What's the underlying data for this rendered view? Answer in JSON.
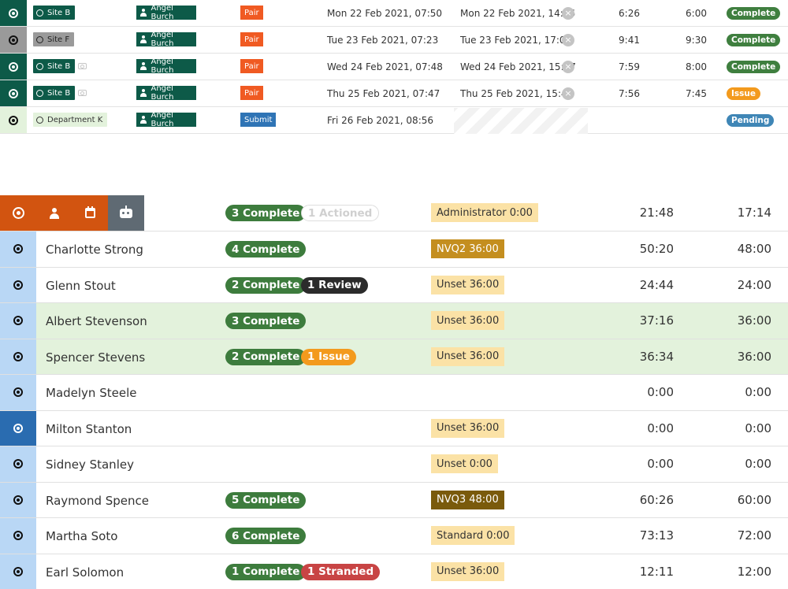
{
  "shifts": [
    {
      "site": "Site B",
      "site_style": "green",
      "camera": false,
      "person": "Angel Burch",
      "action": "Pair",
      "action_style": "pair",
      "start": "Mon 22 Feb 2021, 07:50",
      "end": "Mon 22 Feb 2021, 14:16",
      "clear": "×",
      "worked": "6:26",
      "scheduled": "6:00",
      "status": "Complete",
      "status_style": "complete",
      "selector": "green"
    },
    {
      "site": "Site F",
      "site_style": "grey",
      "camera": false,
      "person": "Angel Burch",
      "action": "Pair",
      "action_style": "pair",
      "start": "Tue 23 Feb 2021, 07:23",
      "end": "Tue 23 Feb 2021, 17:04",
      "clear": "×",
      "worked": "9:41",
      "scheduled": "9:30",
      "status": "Complete",
      "status_style": "complete",
      "selector": "grey"
    },
    {
      "site": "Site B",
      "site_style": "green",
      "camera": true,
      "person": "Angel Burch",
      "action": "Pair",
      "action_style": "pair",
      "start": "Wed 24 Feb 2021, 07:48",
      "end": "Wed 24 Feb 2021, 15:47",
      "clear": "×",
      "worked": "7:59",
      "scheduled": "8:00",
      "status": "Complete",
      "status_style": "complete",
      "selector": "green"
    },
    {
      "site": "Site B",
      "site_style": "green",
      "camera": true,
      "person": "Angel Burch",
      "action": "Pair",
      "action_style": "pair",
      "start": "Thu 25 Feb 2021, 07:47",
      "end": "Thu 25 Feb 2021, 15:43",
      "clear": "×",
      "worked": "7:56",
      "scheduled": "7:45",
      "status": "Issue",
      "status_style": "issue",
      "selector": "green"
    },
    {
      "site": "Department K",
      "site_style": "dept",
      "camera": false,
      "person": "Angel Burch",
      "action": "Submit",
      "action_style": "submit",
      "start": "Fri 26 Feb 2021, 08:56",
      "end": "",
      "clear": "",
      "worked": "",
      "scheduled": "",
      "status": "Pending",
      "status_style": "pending",
      "selector": "light"
    }
  ],
  "staff_header": {
    "pills": [
      {
        "label": "3 Complete",
        "style": "complete"
      },
      {
        "label": "1 Actioned",
        "style": "actioned"
      }
    ],
    "contract": "Administrator 0:00",
    "contract_style": "light",
    "worked": "21:48",
    "scheduled": "17:14",
    "buttons": [
      "target-icon",
      "person-icon",
      "calendar-icon",
      "robot-icon"
    ]
  },
  "staff": [
    {
      "name": "Charlotte Strong",
      "pills": [
        {
          "label": "4 Complete",
          "style": "complete"
        }
      ],
      "contract": "NVQ2 36:00",
      "contract_style": "mid",
      "worked": "50:20",
      "scheduled": "48:00",
      "highlight": false,
      "side": "light"
    },
    {
      "name": "Glenn Stout",
      "pills": [
        {
          "label": "2 Complete",
          "style": "complete"
        },
        {
          "label": "1 Review",
          "style": "review"
        }
      ],
      "contract": "Unset 36:00",
      "contract_style": "light",
      "worked": "24:44",
      "scheduled": "24:00",
      "highlight": false,
      "side": "light"
    },
    {
      "name": "Albert Stevenson",
      "pills": [
        {
          "label": "3 Complete",
          "style": "complete"
        }
      ],
      "contract": "Unset 36:00",
      "contract_style": "light",
      "worked": "37:16",
      "scheduled": "36:00",
      "highlight": true,
      "side": "light"
    },
    {
      "name": "Spencer Stevens",
      "pills": [
        {
          "label": "2 Complete",
          "style": "complete"
        },
        {
          "label": "1 Issue",
          "style": "issue"
        }
      ],
      "contract": "Unset 36:00",
      "contract_style": "light",
      "worked": "36:34",
      "scheduled": "36:00",
      "highlight": true,
      "side": "light"
    },
    {
      "name": "Madelyn Steele",
      "pills": [],
      "contract": "",
      "contract_style": "light",
      "worked": "0:00",
      "scheduled": "0:00",
      "highlight": false,
      "side": "light"
    },
    {
      "name": "Milton Stanton",
      "pills": [],
      "contract": "Unset 36:00",
      "contract_style": "light",
      "worked": "0:00",
      "scheduled": "0:00",
      "highlight": false,
      "side": "dark"
    },
    {
      "name": "Sidney Stanley",
      "pills": [],
      "contract": "Unset 0:00",
      "contract_style": "light",
      "worked": "0:00",
      "scheduled": "0:00",
      "highlight": false,
      "side": "light"
    },
    {
      "name": "Raymond Spence",
      "pills": [
        {
          "label": "5 Complete",
          "style": "complete"
        }
      ],
      "contract": "NVQ3 48:00",
      "contract_style": "dark",
      "worked": "60:26",
      "scheduled": "60:00",
      "highlight": false,
      "side": "light"
    },
    {
      "name": "Martha Soto",
      "pills": [
        {
          "label": "6 Complete",
          "style": "complete"
        }
      ],
      "contract": "Standard 0:00",
      "contract_style": "light",
      "worked": "73:13",
      "scheduled": "72:00",
      "highlight": false,
      "side": "light"
    },
    {
      "name": "Earl Solomon",
      "pills": [
        {
          "label": "1 Complete",
          "style": "complete"
        },
        {
          "label": "1 Stranded",
          "style": "stranded"
        }
      ],
      "contract": "Unset 36:00",
      "contract_style": "light",
      "worked": "12:11",
      "scheduled": "12:00",
      "highlight": false,
      "side": "light"
    }
  ],
  "colors": {
    "selector_green": "#0d5a48",
    "selector_grey": "#9a9a9a",
    "selector_light": "#e3f2dc",
    "site_green": "#0d5a48"
  }
}
